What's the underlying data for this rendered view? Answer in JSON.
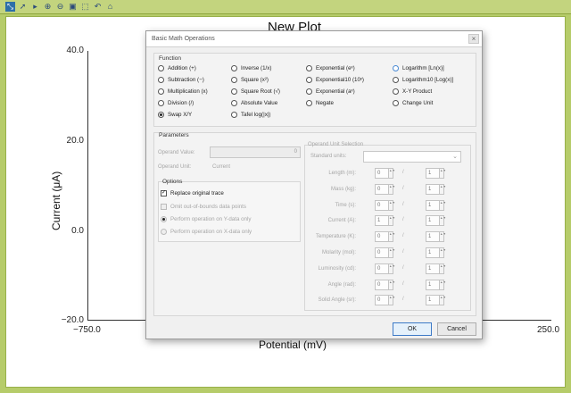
{
  "toolbar": {
    "icons": [
      "select-arrow-icon",
      "pointer-icon",
      "small-arrow-icon",
      "zoom-in-icon",
      "zoom-out-icon",
      "zoom-fit-icon",
      "zoom-box-icon",
      "undo-icon",
      "home-icon"
    ],
    "glyphs": [
      "⤡",
      "➚",
      "▸",
      "⊕",
      "⊖",
      "▣",
      "⬚",
      "↶",
      "⌂"
    ]
  },
  "plot": {
    "title": "New Plot",
    "xlabel": "Potential (mV)",
    "ylabel": "Current (μA)",
    "yticks": [
      "40.0",
      "20.0",
      "0.0",
      "−20.0"
    ],
    "xticks": [
      "−750.0",
      "250.0"
    ]
  },
  "dialog": {
    "title": "Basic Math Operations",
    "close_glyph": "×",
    "function_group": "Function",
    "functions": [
      {
        "label": "Addition (+)",
        "selected": false
      },
      {
        "label": "Subtraction (−)",
        "selected": false
      },
      {
        "label": "Multiplication (x)",
        "selected": false
      },
      {
        "label": "Division (/)",
        "selected": false
      },
      {
        "label": "Swap X/Y",
        "selected": true
      },
      {
        "label": "Inverse (1/x)",
        "selected": false
      },
      {
        "label": "Square (x²)",
        "selected": false
      },
      {
        "label": "Square Root (√)",
        "selected": false
      },
      {
        "label": "Absolute Value",
        "selected": false
      },
      {
        "label": "Tafel log(|x|)",
        "selected": false
      },
      {
        "label": "Exponential (eˣ)",
        "selected": false
      },
      {
        "label": "Exponential10 (10ˣ)",
        "selected": false
      },
      {
        "label": "Exponential (aˣ)",
        "selected": false
      },
      {
        "label": "Negate",
        "selected": false
      },
      {
        "label": "Logarithm [Ln(x)]",
        "selected": false
      },
      {
        "label": "Logarithm10 [Log(x)]",
        "selected": false
      },
      {
        "label": "X-Y Product",
        "selected": false
      },
      {
        "label": "Change Unit",
        "selected": false
      }
    ],
    "parameters_group": "Parameters",
    "operand_value_label": "Operand Value:",
    "operand_value": "0",
    "operand_unit_label": "Operand Unit:",
    "operand_unit": "Current",
    "options_group": "Options",
    "replace_trace_label": "Replace original trace",
    "replace_trace_checked": true,
    "omit_label": "Omit out-of-bounds data points",
    "perform_y_label": "Perform operation on Y-data only",
    "perform_x_label": "Perform operation on X-data only",
    "unit_selection_group": "Operand Unit Selection",
    "standard_units_label": "Standard units:",
    "units": [
      {
        "label": "Length (m):",
        "num": "0",
        "den": "1"
      },
      {
        "label": "Mass (kg):",
        "num": "0",
        "den": "1"
      },
      {
        "label": "Time (s):",
        "num": "0",
        "den": "1"
      },
      {
        "label": "Current (A):",
        "num": "1",
        "den": "1"
      },
      {
        "label": "Temperature (K):",
        "num": "0",
        "den": "1"
      },
      {
        "label": "Molarity (mol):",
        "num": "0",
        "den": "1"
      },
      {
        "label": "Luminosity (cd):",
        "num": "0",
        "den": "1"
      },
      {
        "label": "Angle (rad):",
        "num": "0",
        "den": "1"
      },
      {
        "label": "Solid Angle (sr):",
        "num": "0",
        "den": "1"
      }
    ],
    "slash": "/",
    "spin_glyph": "▲▼",
    "select_glyph": "⌄",
    "ok_label": "OK",
    "cancel_label": "Cancel"
  }
}
